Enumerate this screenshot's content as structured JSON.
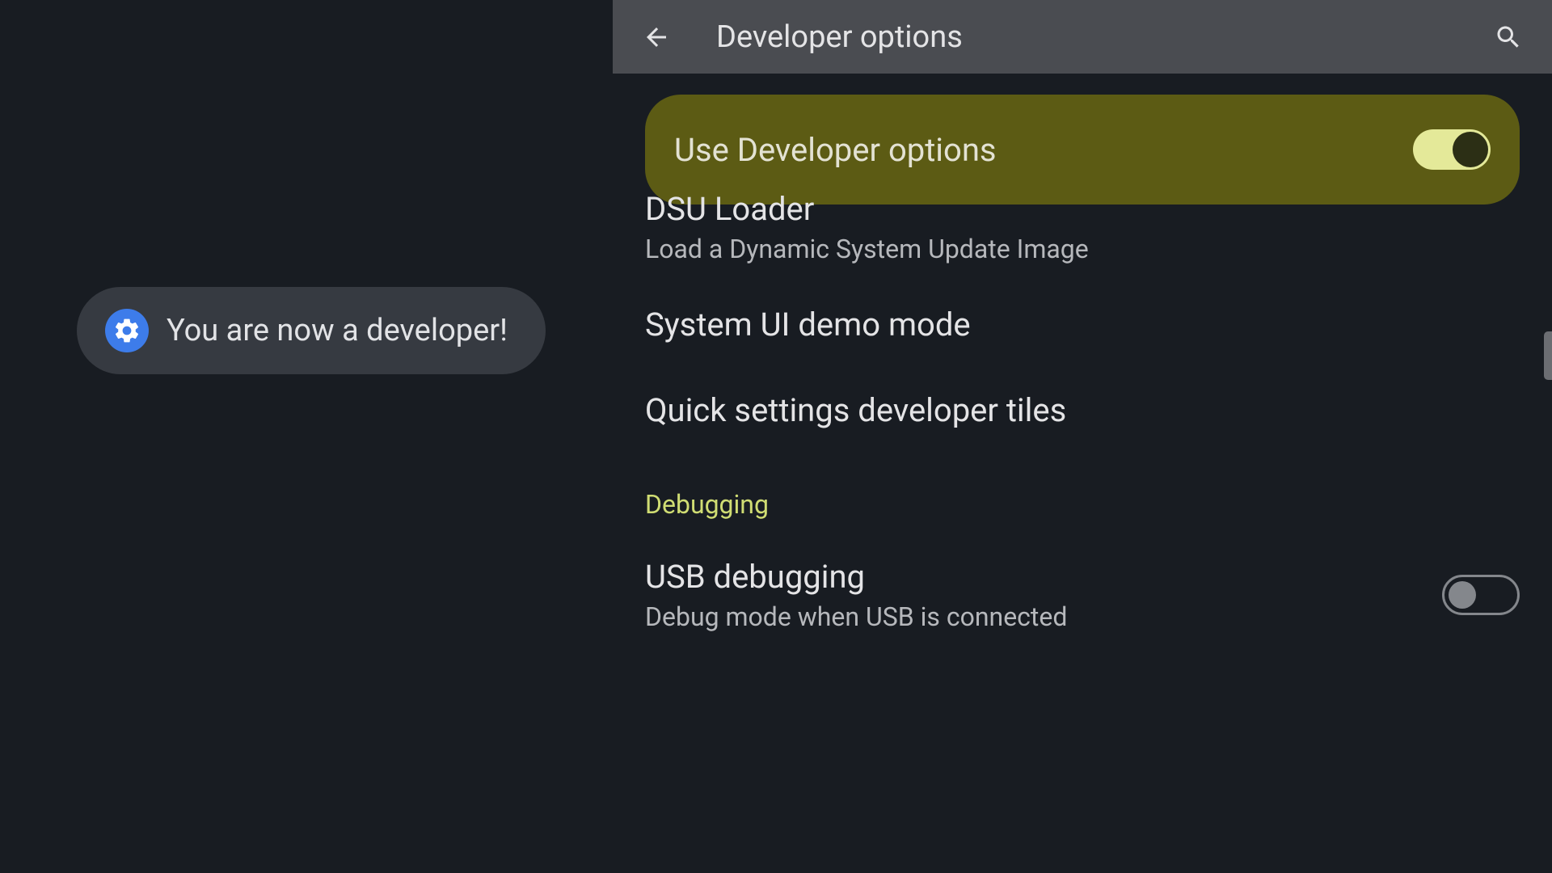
{
  "toast": {
    "message": "You are now a developer!"
  },
  "appBar": {
    "title": "Developer options"
  },
  "highlight": {
    "label": "Use Developer options"
  },
  "settings": {
    "dsu": {
      "title": "DSU Loader",
      "subtitle": "Load a Dynamic System Update Image"
    },
    "systemUi": {
      "title": "System UI demo mode"
    },
    "quickSettings": {
      "title": "Quick settings developer tiles"
    },
    "sectionDebugging": "Debugging",
    "usbDebugging": {
      "title": "USB debugging",
      "subtitle": "Debug mode when USB is connected"
    }
  }
}
